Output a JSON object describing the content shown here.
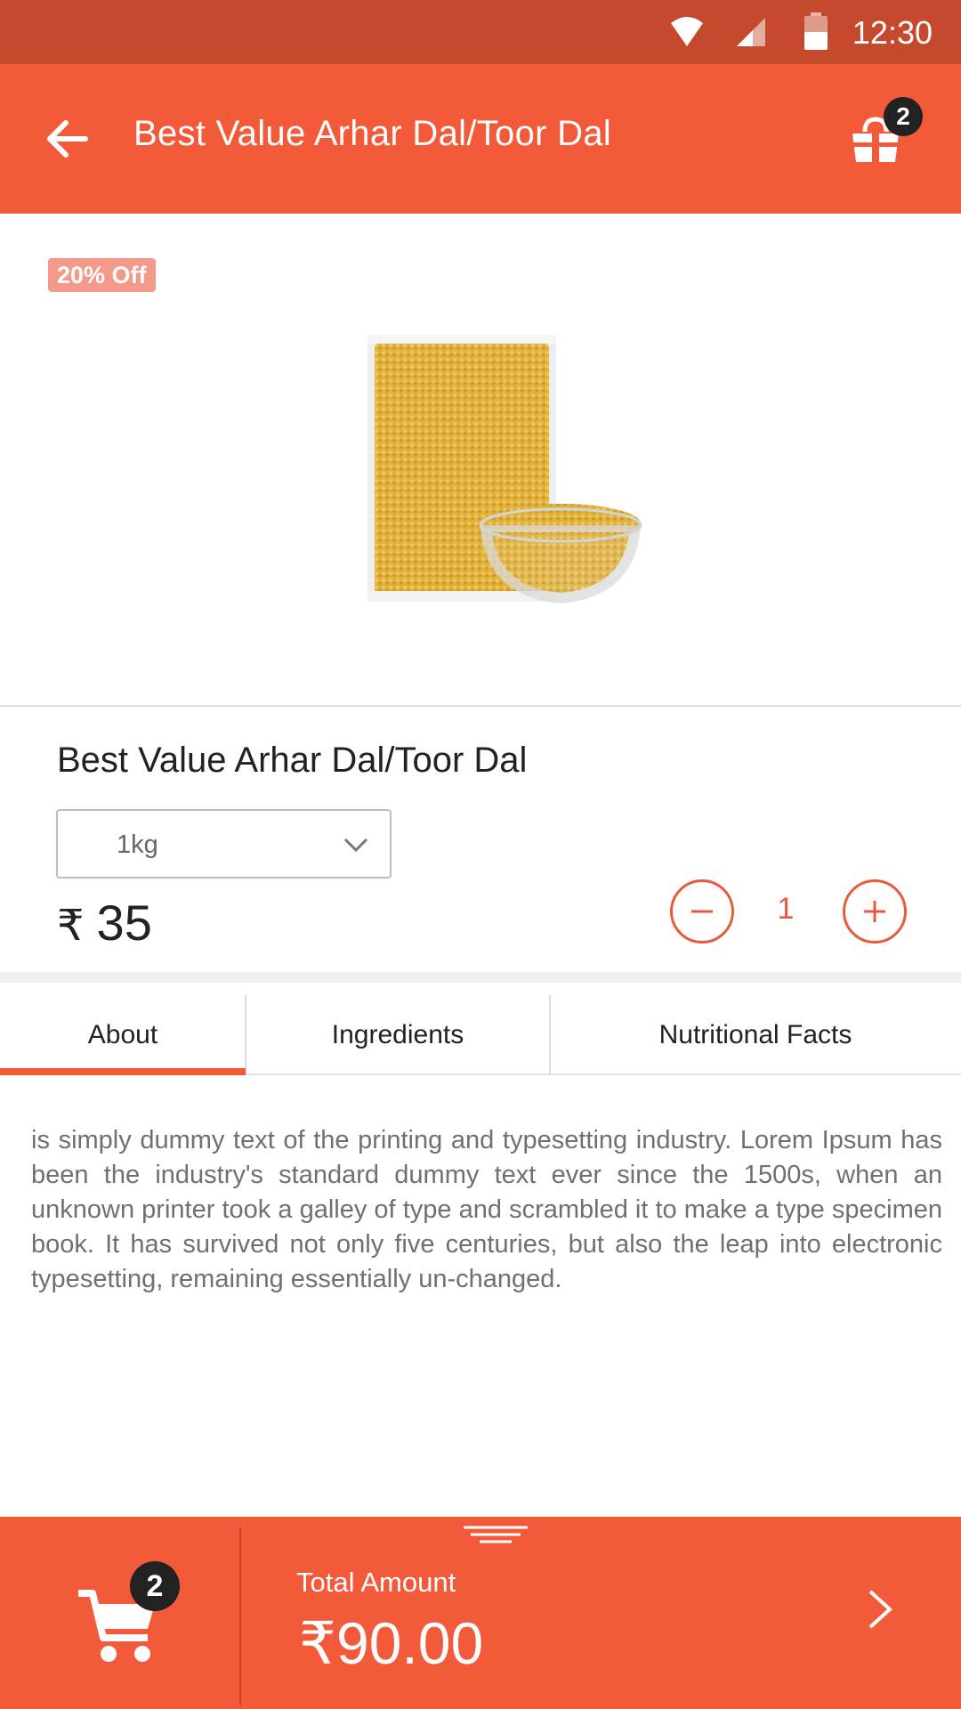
{
  "status_bar": {
    "time": "12:30"
  },
  "header": {
    "title": "Best Value Arhar Dal/Toor Dal",
    "bag_count": "2"
  },
  "product": {
    "discount": "20% Off",
    "name": "Best Value Arhar Dal/Toor Dal",
    "weight": "1kg",
    "currency": "₹",
    "price": "35",
    "quantity": "1"
  },
  "tabs": [
    {
      "label": "About",
      "active": true
    },
    {
      "label": "Ingredients",
      "active": false
    },
    {
      "label": "Nutritional Facts",
      "active": false
    }
  ],
  "about": {
    "text": " is simply dummy text of the printing and typesetting industry. Lorem Ipsum has been the industry's standard dummy text ever since the 1500s, when an unknown printer took a galley of type and scrambled it to make a type specimen book. It has survived not only five centuries, but also the leap into electronic typesetting, remaining essentially un-changed."
  },
  "footer": {
    "cart_count": "2",
    "total_label": "Total Amount",
    "total_amount": "₹90.00"
  },
  "colors": {
    "primary": "#f25a3a",
    "status_bar": "#c5492d",
    "discount_badge": "#f49a8a",
    "badge_dark": "#222222"
  }
}
